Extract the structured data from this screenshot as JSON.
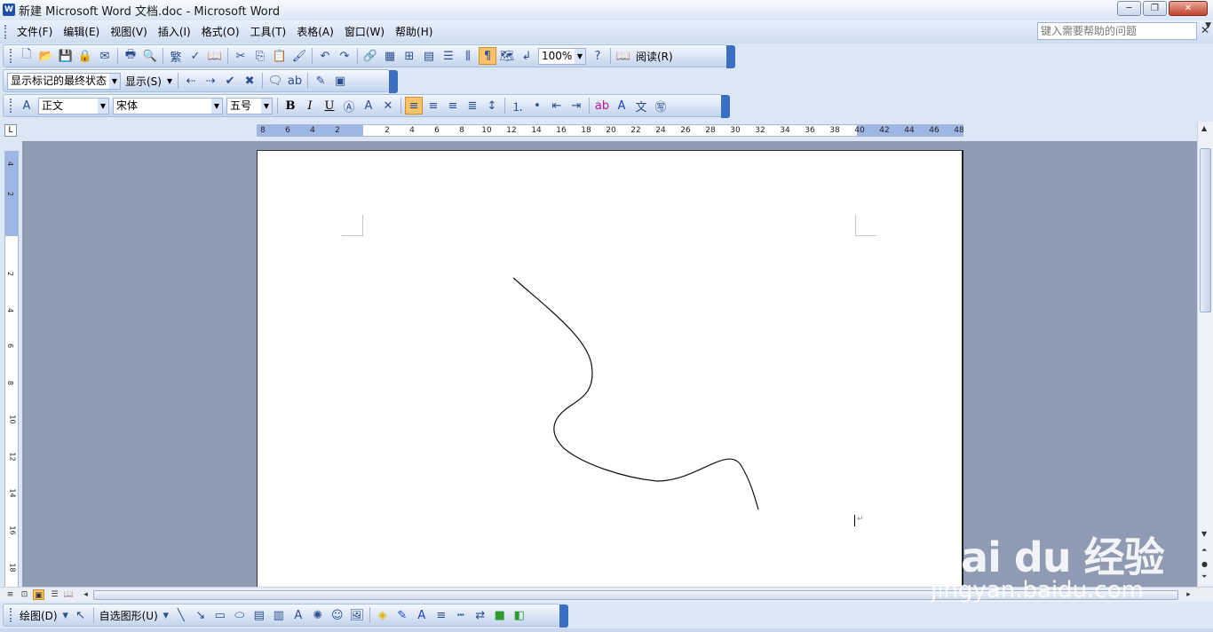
{
  "titlebar": {
    "title": "新建 Microsoft Word 文档.doc - Microsoft Word",
    "minimize": "─",
    "restore": "❐",
    "close": "✕"
  },
  "menu": {
    "items": [
      "文件(F)",
      "编辑(E)",
      "视图(V)",
      "插入(I)",
      "格式(O)",
      "工具(T)",
      "表格(A)",
      "窗口(W)",
      "帮助(H)"
    ],
    "help_placeholder": "键入需要帮助的问题"
  },
  "toolbar_standard": {
    "zoom": "100%",
    "read_label": "阅读(R)"
  },
  "toolbar_review": {
    "markup_state": "显示标记的最终状态",
    "show_label": "显示(S)"
  },
  "toolbar_format": {
    "style": "正文",
    "font": "宋体",
    "size": "五号",
    "bold": "B",
    "italic": "I",
    "underline": "U"
  },
  "ruler": {
    "h_labels": [
      "8",
      "6",
      "4",
      "2",
      "2",
      "4",
      "6",
      "8",
      "10",
      "12",
      "14",
      "16",
      "18",
      "20",
      "22",
      "24",
      "26",
      "28",
      "30",
      "32",
      "34",
      "36",
      "38",
      "40",
      "42",
      "44",
      "46",
      "48"
    ],
    "v_labels": [
      "4",
      "2",
      "2",
      "4",
      "6",
      "8",
      "10",
      "12",
      "14",
      "16",
      "18"
    ],
    "corner": "L"
  },
  "drawing_toolbar": {
    "draw_label": "绘图(D)",
    "autoshapes_label": "自选图形(U)"
  },
  "watermark": {
    "brand": "Bai du 经验",
    "url": "jingyan.baidu.com"
  }
}
